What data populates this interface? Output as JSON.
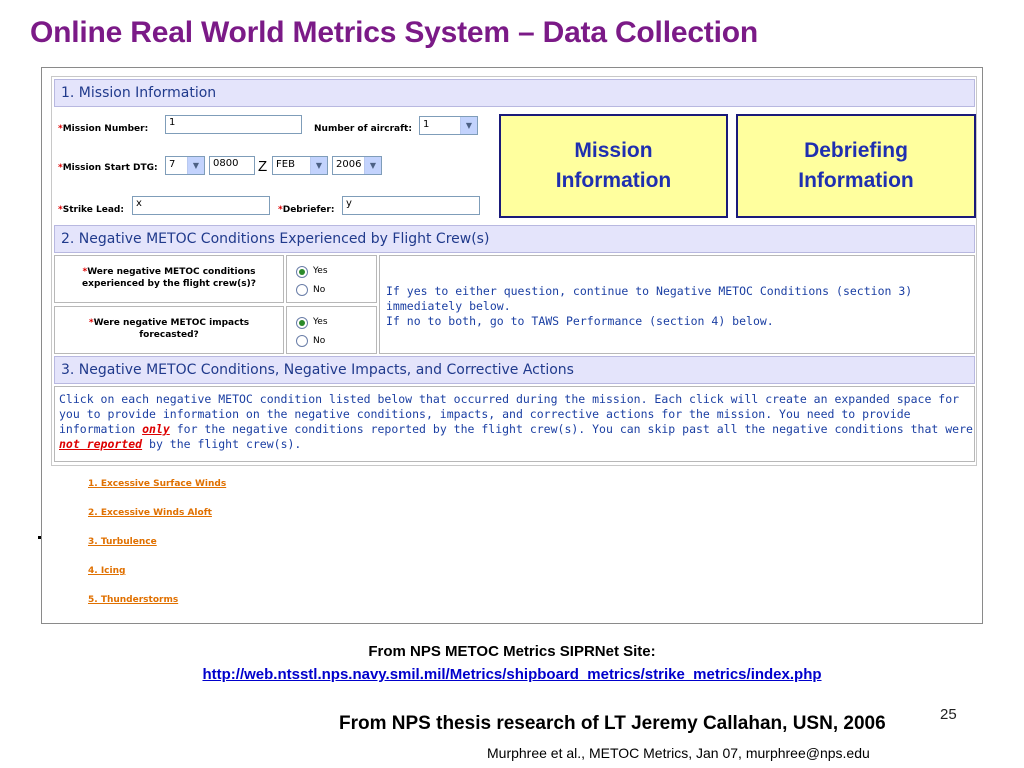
{
  "slide": {
    "title": "Online Real World Metrics System – Data Collection",
    "source_label": "From NPS METOC Metrics SIPRNet Site:",
    "source_url": "http://web.ntsstl.nps.navy.smil.mil/Metrics/shipboard_metrics/strike_metrics/index.php",
    "credit": "From NPS thesis research of LT Jeremy Callahan, USN, 2006",
    "page_number": "25",
    "footer": "Murphree et al., METOC Metrics, Jan 07, murphree@nps.edu"
  },
  "section1": {
    "header": "1. Mission Information",
    "required_mark": "*",
    "mission_number_label": "Mission Number:",
    "mission_number_value": "1",
    "num_aircraft_label": "Number of aircraft:",
    "num_aircraft_value": "1",
    "start_dtg_label": "Mission Start DTG:",
    "dtg_day": "7",
    "dtg_time": "0800",
    "dtg_zone": "Z",
    "dtg_month": "FEB",
    "dtg_year": "2006",
    "strike_lead_label": "Strike Lead:",
    "strike_lead_value": "x",
    "debriefer_label": "Debriefer:",
    "debriefer_value": "y"
  },
  "callouts": {
    "mission_line1": "Mission",
    "mission_line2": "Information",
    "debrief_line1": "Debriefing",
    "debrief_line2": "Information"
  },
  "section2": {
    "header": "2. Negative METOC Conditions Experienced by Flight Crew(s)",
    "q1_line1": "Were negative METOC conditions",
    "q1_line2": "experienced by the flight crew(s)?",
    "q2_line1": "Were negative METOC impacts",
    "q2_line2": "forecasted?",
    "yes": "Yes",
    "no": "No",
    "instr_line1": "If yes to either question, continue to Negative METOC Conditions (section 3)",
    "instr_line2": "immediately below.",
    "instr_line3": "If no to both, go to TAWS Performance (section 4) below."
  },
  "section3": {
    "header": "3. Negative METOC Conditions, Negative Impacts, and Corrective Actions",
    "line1": "Click on each negative METOC condition listed below that occurred during the mission.  Each click will create an expanded space for",
    "line2": "you to provide information on the negative conditions, impacts, and corrective actions for the mission.  You need to provide",
    "line3a": "information ",
    "line3_only": "only",
    "line3b": " for the negative conditions reported by the flight crew(s).  You can skip past all the negative conditions that were",
    "line4_not": "not reported",
    "line4b": " by the flight crew(s).",
    "conditions": [
      "1. Excessive Surface Winds",
      "2. Excessive Winds Aloft",
      "3. Turbulence",
      "4. Icing",
      "5. Thunderstorms"
    ]
  }
}
